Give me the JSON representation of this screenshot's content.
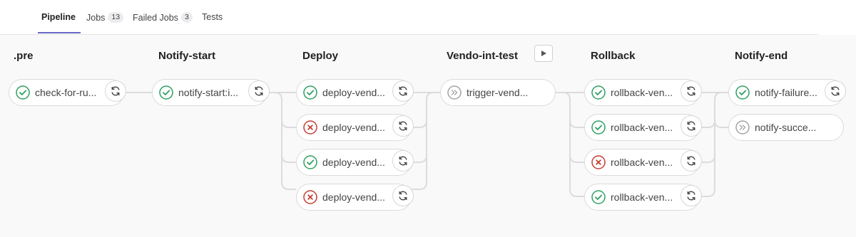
{
  "tabs": [
    {
      "label": "Pipeline",
      "count": null,
      "active": true
    },
    {
      "label": "Jobs",
      "count": "13",
      "active": false
    },
    {
      "label": "Failed Jobs",
      "count": "3",
      "active": false
    },
    {
      "label": "Tests",
      "count": null,
      "active": false
    }
  ],
  "colors": {
    "success": "#2da160",
    "failed": "#c43d32",
    "skipped": "#a4a4a4",
    "accent": "#6666c4"
  },
  "stages": [
    {
      "title": ".pre",
      "jobs": [
        {
          "name": "check-for-ru...",
          "status": "success",
          "icon": "status-success-icon"
        }
      ]
    },
    {
      "title": "Notify-start",
      "jobs": [
        {
          "name": "notify-start:i...",
          "status": "success",
          "icon": "status-success-icon"
        }
      ]
    },
    {
      "title": "Deploy",
      "jobs": [
        {
          "name": "deploy-vend...",
          "status": "success",
          "icon": "status-success-icon"
        },
        {
          "name": "deploy-vend...",
          "status": "failed",
          "icon": "status-failed-icon"
        },
        {
          "name": "deploy-vend...",
          "status": "success",
          "icon": "status-success-icon"
        },
        {
          "name": "deploy-vend...",
          "status": "failed",
          "icon": "status-failed-icon"
        }
      ]
    },
    {
      "title": "Vendo-int-test",
      "action_icon": "play-icon",
      "jobs": [
        {
          "name": "trigger-vend...",
          "status": "skipped",
          "icon": "status-skipped-icon"
        }
      ]
    },
    {
      "title": "Rollback",
      "jobs": [
        {
          "name": "rollback-ven...",
          "status": "success",
          "icon": "status-success-icon"
        },
        {
          "name": "rollback-ven...",
          "status": "success",
          "icon": "status-success-icon"
        },
        {
          "name": "rollback-ven...",
          "status": "failed",
          "icon": "status-failed-icon"
        },
        {
          "name": "rollback-ven...",
          "status": "success",
          "icon": "status-success-icon"
        }
      ]
    },
    {
      "title": "Notify-end",
      "jobs": [
        {
          "name": "notify-failure...",
          "status": "success",
          "icon": "status-success-icon"
        },
        {
          "name": "notify-succe...",
          "status": "skipped",
          "icon": "status-skipped-icon"
        }
      ]
    }
  ]
}
